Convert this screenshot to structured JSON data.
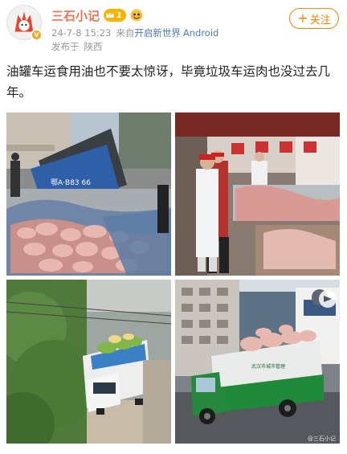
{
  "header": {
    "username": "三石小记",
    "level": "1",
    "timestamp": "24-7-8 15:23",
    "source_prefix": "来自",
    "source_name": "开启新世界",
    "device": "Android",
    "location_prefix": "发布于",
    "location": "陕西",
    "follow_label": "关注",
    "follow_plus": "+"
  },
  "post": {
    "text": "油罐车运食用油也不要太惊讶，毕竟垃圾车运肉也没过去几年。"
  },
  "images": [
    {
      "plate": "鄂A·B83 66"
    },
    {},
    {},
    {
      "truck_text": "武汉市城市管理"
    }
  ],
  "watermark": "@三石小记",
  "colors": {
    "username": "#eb7350",
    "follow": "#ff8200",
    "source_link": "#4a7bbd",
    "meta": "#999999"
  }
}
